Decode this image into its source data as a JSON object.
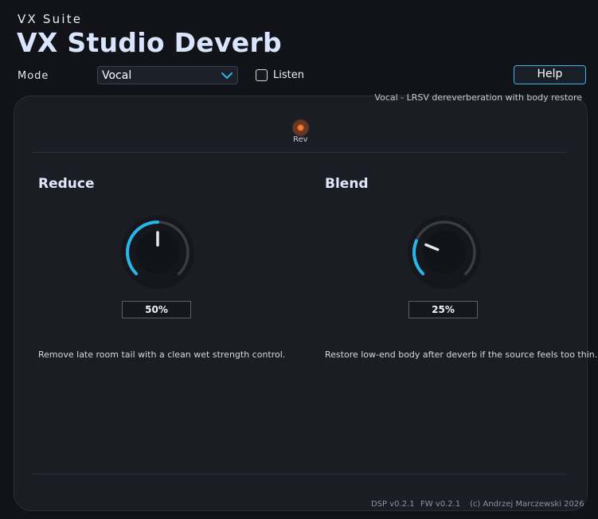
{
  "header": {
    "suite": "VX Suite",
    "title": "VX Studio Deverb"
  },
  "mode": {
    "label": "Mode",
    "selected": "Vocal",
    "description": "Vocal - LRSV dereverberation with body restore"
  },
  "listen": {
    "label": "Listen",
    "checked": false
  },
  "help": {
    "label": "Help"
  },
  "indicator": {
    "label": "Rev",
    "active": true
  },
  "reduce": {
    "title": "Reduce",
    "value_text": "50%",
    "value": 0.5,
    "description": "Remove late room tail with a clean wet strength control."
  },
  "blend": {
    "title": "Blend",
    "value_text": "25%",
    "value": 0.25,
    "description": "Restore low-end body after deverb if the source feels too thin."
  },
  "footer": {
    "dsp": "DSP v0.2.1",
    "fw": "FW v0.2.1",
    "copyright": "(c) Andrzej Marczewski 2026"
  },
  "colors": {
    "accent": "#29b6e8",
    "led": "#ff7a2a",
    "title": "#d9e4ff"
  }
}
